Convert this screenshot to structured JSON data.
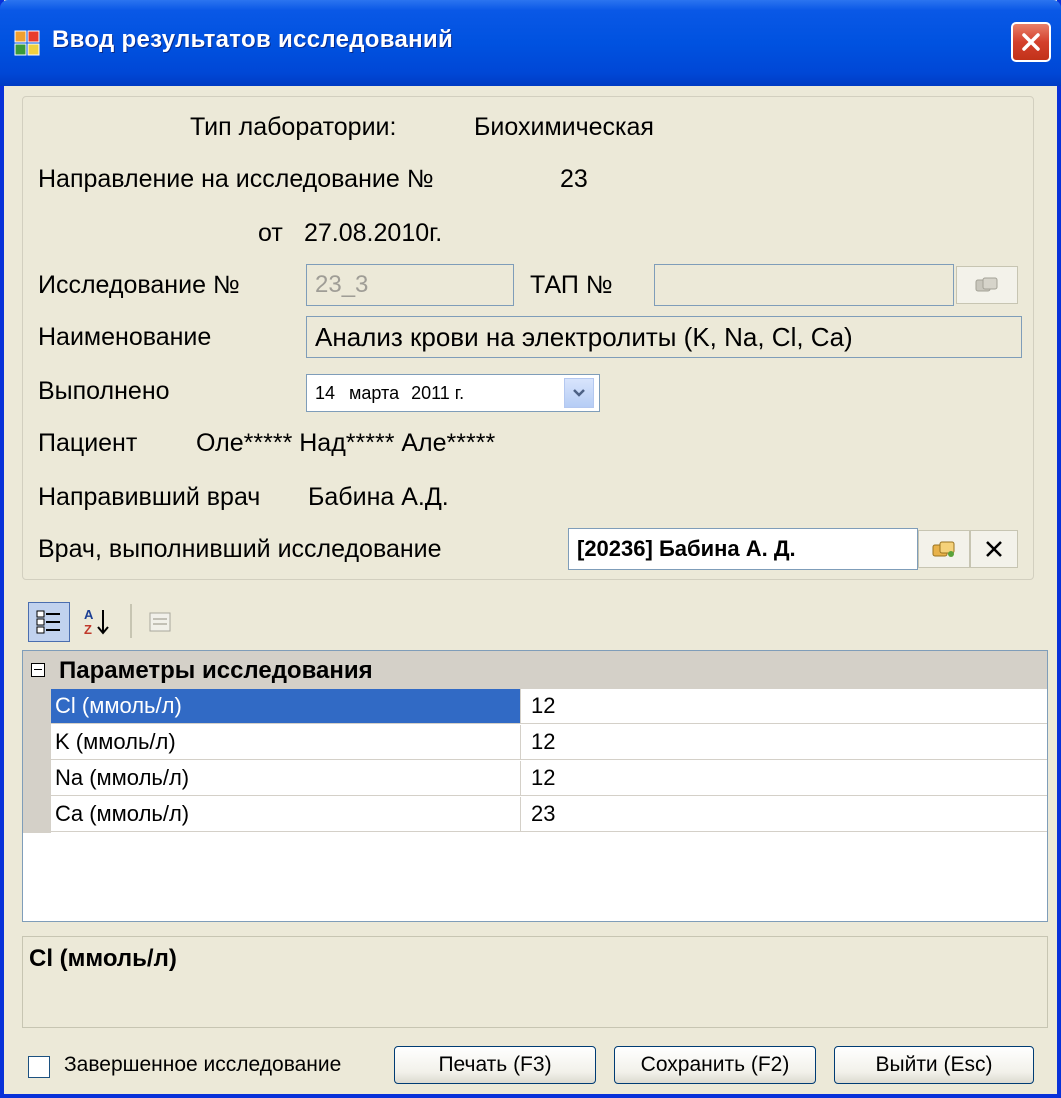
{
  "window": {
    "title": "Ввод результатов исследований"
  },
  "header": {
    "lab_type_label": "Тип лаборатории:",
    "lab_type_value": "Биохимическая",
    "referral_label": "Направление на исследование №",
    "referral_number": "23",
    "date_prefix": "от",
    "date_value": "27.08.2010г."
  },
  "form": {
    "study_number_label": "Исследование №",
    "study_number_value": "23_3",
    "tap_label": "ТАП №",
    "tap_value": "",
    "name_label": "Наименование",
    "name_value": "Анализ крови на электролиты (K, Na, Cl, Ca)",
    "done_label": "Выполнено",
    "done_day": "14",
    "done_month": "марта",
    "done_year": "2011 г.",
    "patient_label": "Пациент",
    "patient_value": "Оле***** Над***** Але*****",
    "referring_doctor_label": "Направивший врач",
    "referring_doctor_value": "Бабина А.Д.",
    "performing_doctor_label": "Врач, выполнивший исследование",
    "performing_doctor_value": "[20236] Бабина А. Д."
  },
  "grid": {
    "category": "Параметры исследования",
    "rows": [
      {
        "name": "Cl (ммоль/л)",
        "value": "12"
      },
      {
        "name": "K (ммоль/л)",
        "value": "12"
      },
      {
        "name": "Na (ммоль/л)",
        "value": "12"
      },
      {
        "name": "Ca (ммоль/л)",
        "value": "23"
      }
    ],
    "selected_description": "Cl (ммоль/л)"
  },
  "footer": {
    "completed_label": "Завершенное исследование",
    "print_button": "Печать (F3)",
    "save_button": "Сохранить (F2)",
    "exit_button": "Выйти (Esc)"
  },
  "colors": {
    "title_bar": "#0052e0",
    "selection": "#316ac5",
    "window_bg": "#ece9d8"
  }
}
